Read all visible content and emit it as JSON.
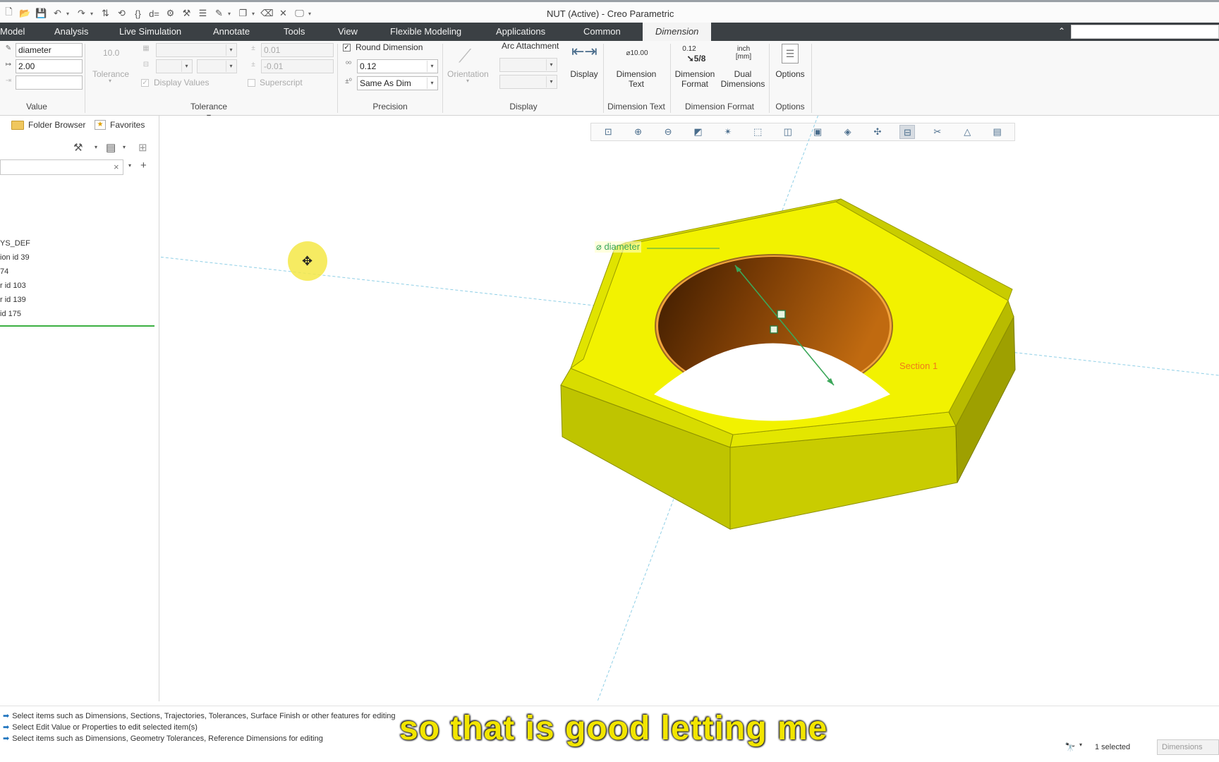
{
  "window": {
    "title": "NUT (Active) - Creo Parametric"
  },
  "quick_access": [
    "new-icon",
    "open-icon",
    "save-icon",
    "undo-icon",
    "redo-icon",
    "regenerate-icon",
    "windows-icon",
    "close-icon"
  ],
  "tabs": [
    "Model",
    "Analysis",
    "Live Simulation",
    "Annotate",
    "Tools",
    "View",
    "Flexible Modeling",
    "Applications",
    "Common",
    "Dimension"
  ],
  "ribbon": {
    "value": {
      "name_field": "diameter",
      "value_field": "2.00",
      "tolerance_preview": "10.0",
      "tolerance_label": "Tolerance",
      "group_label": "Value"
    },
    "tolerance": {
      "upper": "0.01",
      "lower": "-0.01",
      "display_values_label": "Display Values",
      "superscript_label": "Superscript",
      "group_label": "Tolerance"
    },
    "precision": {
      "round_dimension_label": "Round Dimension",
      "round_dimension_checked": true,
      "decimals_value": "0.12",
      "tolerance_decimals_value": "Same As Dim",
      "group_label": "Precision"
    },
    "display": {
      "orientation_label": "Orientation",
      "arc_attachment_label": "Arc Attachment",
      "display_button_label": "Display",
      "group_label": "Display"
    },
    "dimension_text": {
      "preview": "⌀10.00",
      "label_line1": "Dimension",
      "label_line2": "Text",
      "group_label": "Dimension Text"
    },
    "dimension_format": {
      "format_preview_top": "0.12",
      "format_preview_bottom": "5/8",
      "format_label_line1": "Dimension",
      "format_label_line2": "Format",
      "dual_preview_top": "inch",
      "dual_preview_bottom": "[mm]",
      "dual_label_line1": "Dual",
      "dual_label_line2": "Dimensions",
      "group_label": "Dimension Format"
    },
    "options": {
      "button_label": "Options",
      "group_label": "Options"
    }
  },
  "navigator": {
    "tabs": [
      "Folder Browser",
      "Favorites"
    ],
    "tree_items": [
      "YS_DEF",
      "ion id 39",
      "74",
      "r id 103",
      "r id 139",
      "id 175"
    ]
  },
  "model_view": {
    "dimension_label": "⌀ diameter",
    "section_label": "Section 1"
  },
  "messages": [
    "Select items such as Dimensions, Sections, Trajectories, Tolerances, Surface Finish or other features for editing",
    "Select Edit Value or Properties to edit selected item(s)",
    "Select items such as Dimensions, Geometry Tolerances, Reference Dimensions for editing"
  ],
  "status": {
    "selected": "1 selected",
    "filter": "Dimensions"
  },
  "caption": "so that is good letting me"
}
